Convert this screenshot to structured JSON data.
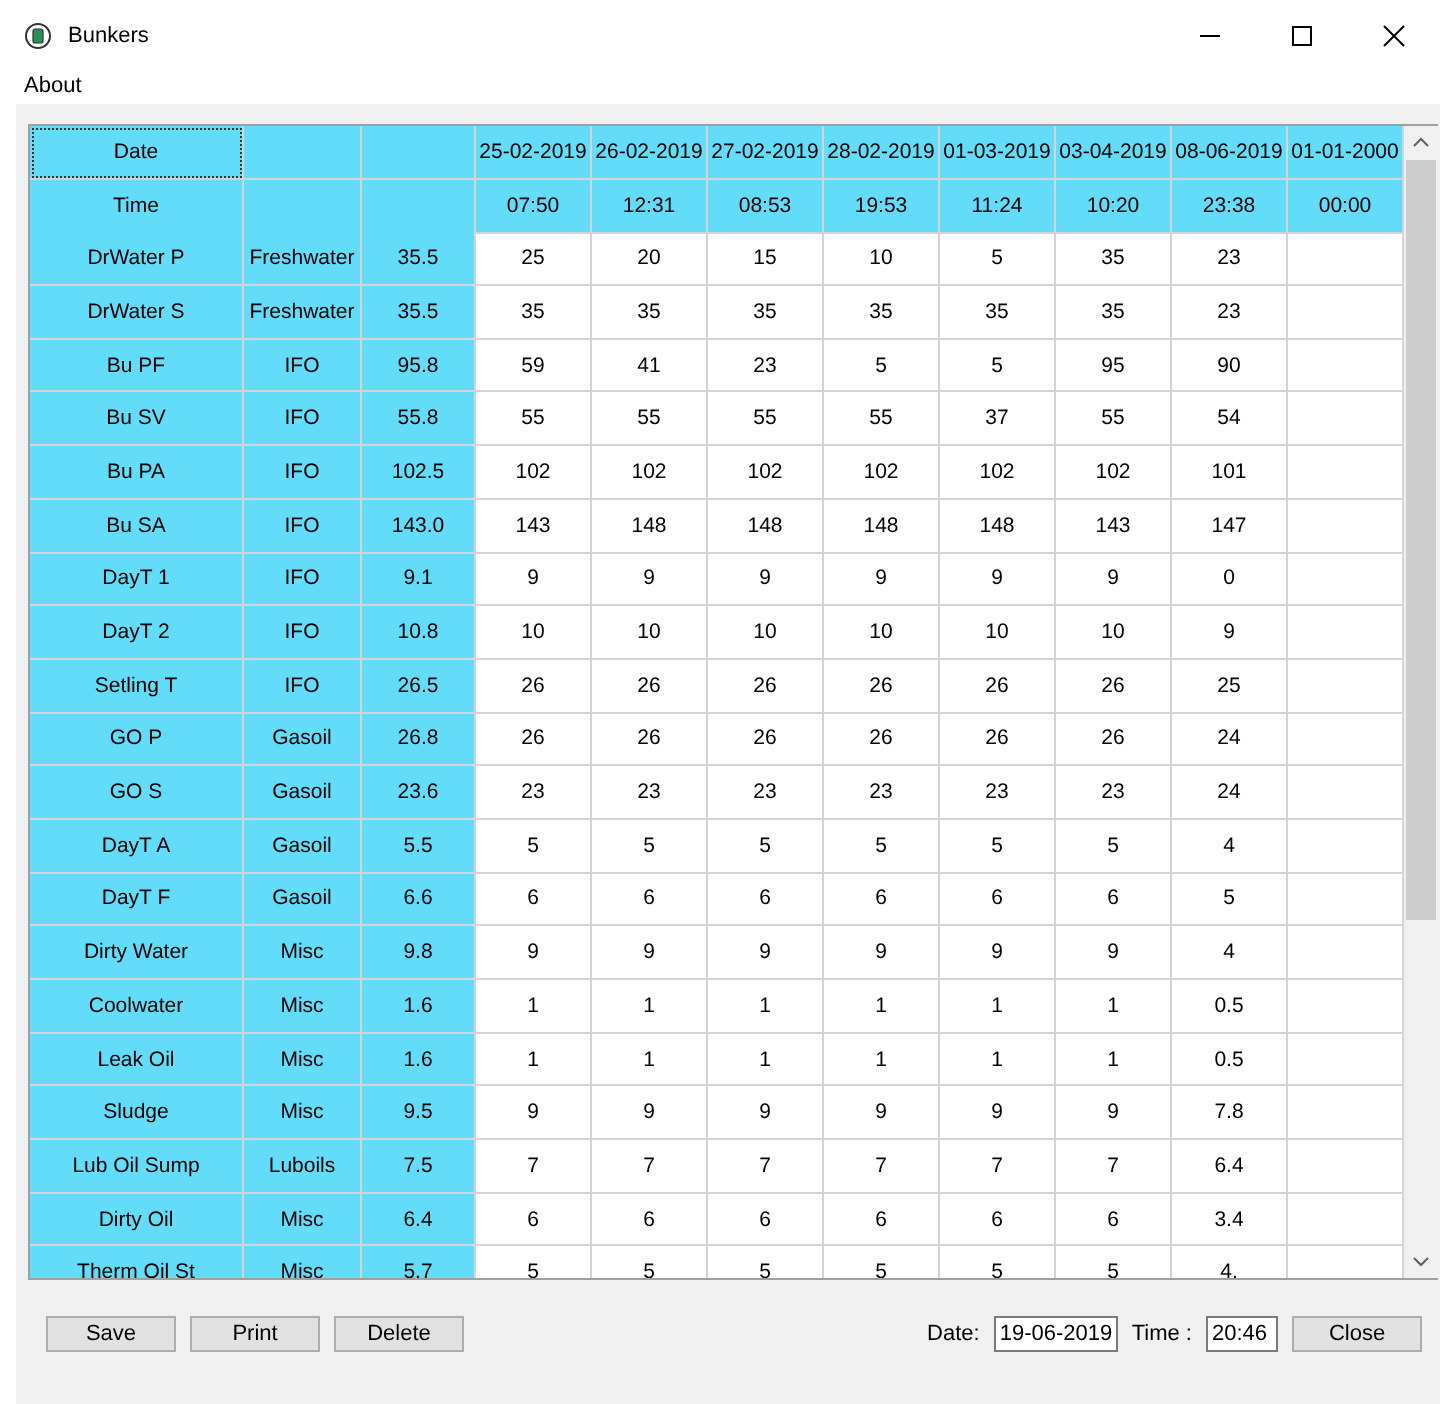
{
  "window": {
    "title": "Bunkers"
  },
  "menu": [
    "About"
  ],
  "table": {
    "header_rows": [
      {
        "label": "Date",
        "cells": [
          "25-02-2019",
          "26-02-2019",
          "27-02-2019",
          "28-02-2019",
          "01-03-2019",
          "03-04-2019",
          "08-06-2019",
          "01-01-2000"
        ]
      },
      {
        "label": "Time",
        "cells": [
          "07:50",
          "12:31",
          "08:53",
          "19:53",
          "11:24",
          "10:20",
          "23:38",
          "00:00"
        ]
      }
    ],
    "rows": [
      {
        "name": "DrWater P",
        "type": "Freshwater",
        "capacity": "35.5",
        "values": [
          "25",
          "20",
          "15",
          "10",
          "5",
          "35",
          "23"
        ]
      },
      {
        "name": "DrWater S",
        "type": "Freshwater",
        "capacity": "35.5",
        "values": [
          "35",
          "35",
          "35",
          "35",
          "35",
          "35",
          "23"
        ]
      },
      {
        "name": "Bu PF",
        "type": "IFO",
        "capacity": "95.8",
        "values": [
          "59",
          "41",
          "23",
          "5",
          "5",
          "95",
          "90"
        ]
      },
      {
        "name": "Bu SV",
        "type": "IFO",
        "capacity": "55.8",
        "values": [
          "55",
          "55",
          "55",
          "55",
          "37",
          "55",
          "54"
        ]
      },
      {
        "name": "Bu PA",
        "type": "IFO",
        "capacity": "102.5",
        "values": [
          "102",
          "102",
          "102",
          "102",
          "102",
          "102",
          "101"
        ]
      },
      {
        "name": "Bu SA",
        "type": "IFO",
        "capacity": "143.0",
        "values": [
          "143",
          "148",
          "148",
          "148",
          "148",
          "143",
          "147"
        ]
      },
      {
        "name": "DayT 1",
        "type": "IFO",
        "capacity": "9.1",
        "values": [
          "9",
          "9",
          "9",
          "9",
          "9",
          "9",
          "0"
        ]
      },
      {
        "name": "DayT 2",
        "type": "IFO",
        "capacity": "10.8",
        "values": [
          "10",
          "10",
          "10",
          "10",
          "10",
          "10",
          "9"
        ]
      },
      {
        "name": "Setling T",
        "type": "IFO",
        "capacity": "26.5",
        "values": [
          "26",
          "26",
          "26",
          "26",
          "26",
          "26",
          "25"
        ]
      },
      {
        "name": "GO P",
        "type": "Gasoil",
        "capacity": "26.8",
        "values": [
          "26",
          "26",
          "26",
          "26",
          "26",
          "26",
          "24"
        ]
      },
      {
        "name": "GO S",
        "type": "Gasoil",
        "capacity": "23.6",
        "values": [
          "23",
          "23",
          "23",
          "23",
          "23",
          "23",
          "24"
        ]
      },
      {
        "name": "DayT A",
        "type": "Gasoil",
        "capacity": "5.5",
        "values": [
          "5",
          "5",
          "5",
          "5",
          "5",
          "5",
          "4"
        ]
      },
      {
        "name": "DayT F",
        "type": "Gasoil",
        "capacity": "6.6",
        "values": [
          "6",
          "6",
          "6",
          "6",
          "6",
          "6",
          "5"
        ]
      },
      {
        "name": "Dirty Water",
        "type": "Misc",
        "capacity": "9.8",
        "values": [
          "9",
          "9",
          "9",
          "9",
          "9",
          "9",
          "4"
        ]
      },
      {
        "name": "Coolwater",
        "type": "Misc",
        "capacity": "1.6",
        "values": [
          "1",
          "1",
          "1",
          "1",
          "1",
          "1",
          "0.5"
        ]
      },
      {
        "name": "Leak Oil",
        "type": "Misc",
        "capacity": "1.6",
        "values": [
          "1",
          "1",
          "1",
          "1",
          "1",
          "1",
          "0.5"
        ]
      },
      {
        "name": "Sludge",
        "type": "Misc",
        "capacity": "9.5",
        "values": [
          "9",
          "9",
          "9",
          "9",
          "9",
          "9",
          "7.8"
        ]
      },
      {
        "name": "Lub Oil Sump",
        "type": "Luboils",
        "capacity": "7.5",
        "values": [
          "7",
          "7",
          "7",
          "7",
          "7",
          "7",
          "6.4"
        ]
      },
      {
        "name": "Dirty Oil",
        "type": "Misc",
        "capacity": "6.4",
        "values": [
          "6",
          "6",
          "6",
          "6",
          "6",
          "6",
          "3.4"
        ]
      },
      {
        "name": "Therm Oil St",
        "type": "Misc",
        "capacity": "5.7",
        "values": [
          "5",
          "5",
          "5",
          "5",
          "5",
          "5",
          "4."
        ]
      }
    ]
  },
  "buttons_left": [
    "Save",
    "Print",
    "Delete"
  ],
  "date_label": "Date:",
  "date_value": "19-06-2019",
  "time_label": "Time :",
  "time_value": "20:46",
  "close_button": "Close"
}
